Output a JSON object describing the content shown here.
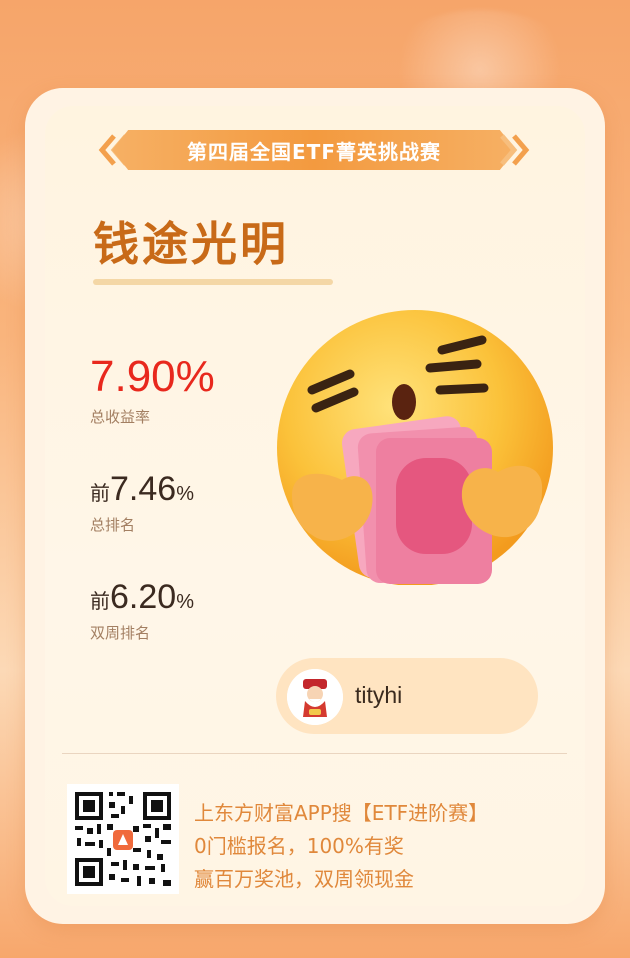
{
  "banner": "第四届全国ETF菁英挑战赛",
  "title": "钱途光明",
  "total_return": {
    "value": "7.90%",
    "label": "总收益率"
  },
  "total_rank": {
    "prefix": "前",
    "value": "7.46",
    "suffix": "%",
    "label": "总排名"
  },
  "biweekly_rank": {
    "prefix": "前",
    "value": "6.20",
    "suffix": "%",
    "label": "双周排名"
  },
  "user": {
    "name": "tityhi"
  },
  "promo": {
    "line1": "上东方财富APP搜【ETF进阶赛】",
    "line2": "0门槛报名，100%有奖",
    "line3": "赢百万奖池，双周领现金"
  },
  "colors": {
    "accent": "#c86a18",
    "return_red": "#e8281d",
    "banner": "#f39a3f"
  }
}
